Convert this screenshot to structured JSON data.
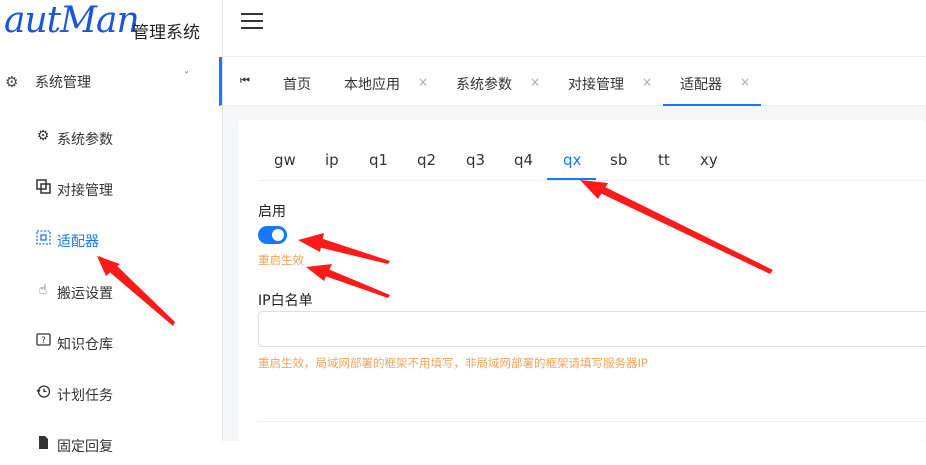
{
  "logo": {
    "script_text": "autMan",
    "title": "管理系统"
  },
  "sidebar": {
    "group": {
      "label": "系统管理",
      "icon": "gear-icon",
      "chevron": "˅"
    },
    "items": [
      {
        "label": "系统参数",
        "icon": "gear-icon"
      },
      {
        "label": "对接管理",
        "icon": "link-square-icon"
      },
      {
        "label": "适配器",
        "icon": "adapter-icon",
        "active": true
      },
      {
        "label": "搬运设置",
        "icon": "hand-pointer-icon"
      },
      {
        "label": "知识仓库",
        "icon": "question-square-icon"
      },
      {
        "label": "计划任务",
        "icon": "history-icon"
      },
      {
        "label": "固定回复",
        "icon": "file-icon"
      }
    ]
  },
  "tabs": {
    "first_icon": "⏮",
    "items": [
      {
        "label": "首页"
      },
      {
        "label": "本地应用",
        "close": "×"
      },
      {
        "label": "系统参数",
        "close": "×"
      },
      {
        "label": "对接管理",
        "close": "×"
      },
      {
        "label": "适配器",
        "close": "×",
        "active": true
      }
    ]
  },
  "adapter_tabs": [
    "gw",
    "ip",
    "q1",
    "q2",
    "q3",
    "q4",
    "qx",
    "sb",
    "tt",
    "xy"
  ],
  "adapter_active": "qx",
  "form": {
    "enable_label": "启用",
    "enable_on": true,
    "enable_hint": "重启生效",
    "whitelist_label": "IP白名单",
    "whitelist_value": "",
    "whitelist_hint": "重启生效，局域网部署的框架不用填写，非局域网部署的框架请填写服务器IP"
  },
  "colors": {
    "accent": "#1677ff",
    "hint": "#f2a35c",
    "annotation": "#ff1a1a"
  }
}
